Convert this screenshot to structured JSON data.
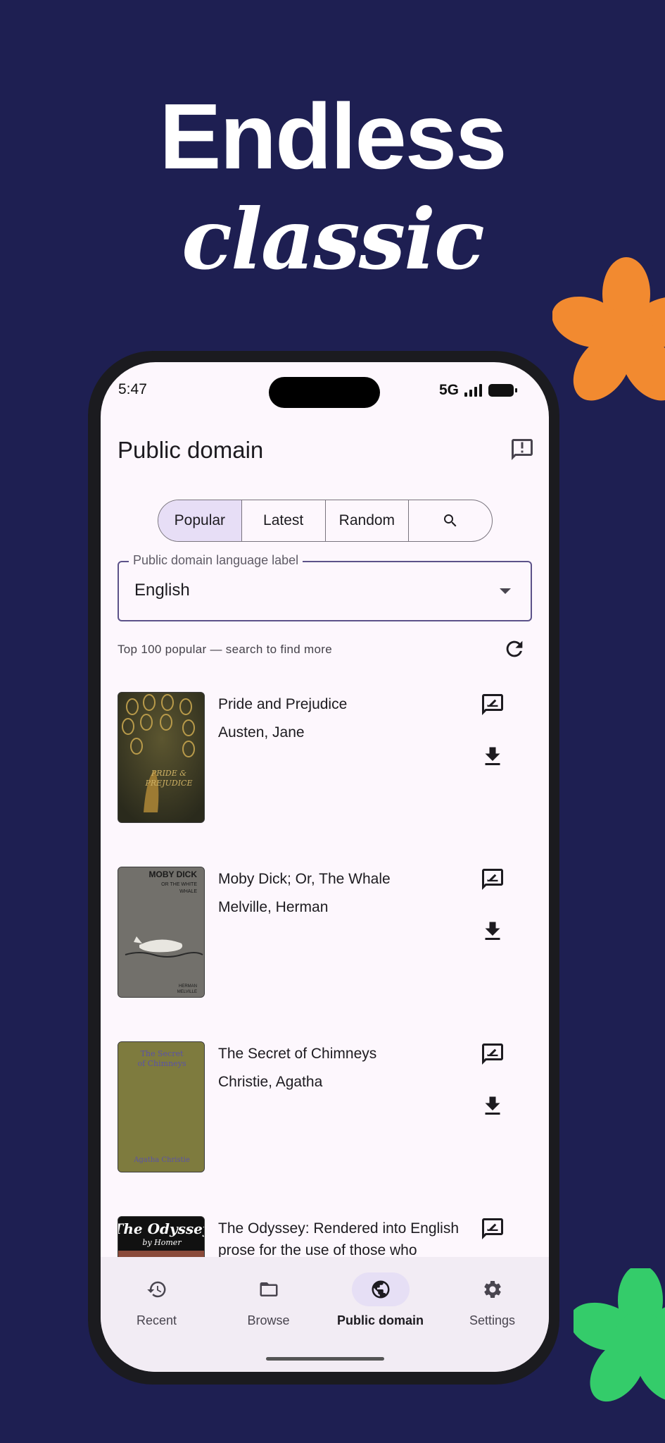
{
  "headline": {
    "line1": "Endless",
    "line2": "classic"
  },
  "status_bar": {
    "time": "5:47",
    "network": "5G"
  },
  "header": {
    "title": "Public domain",
    "feedback_icon": "feedback-icon"
  },
  "segments": [
    {
      "label": "Popular",
      "active": true
    },
    {
      "label": "Latest",
      "active": false
    },
    {
      "label": "Random",
      "active": false
    },
    {
      "label": "",
      "icon": "search-icon",
      "active": false
    }
  ],
  "language_select": {
    "label": "Public domain language label",
    "value": "English"
  },
  "info": {
    "text": "Top 100 popular — search to find more"
  },
  "books": [
    {
      "title": "Pride and Prejudice",
      "author": "Austen, Jane",
      "cover_text": "PRIDE & PREJUDICE"
    },
    {
      "title": "Moby Dick; Or, The Whale",
      "author": "Melville, Herman",
      "cover_text": "MOBY DICK",
      "cover_subtext": "OR THE WHITE WHALE",
      "cover_author": "HERMAN MELVILLE"
    },
    {
      "title": "The Secret of Chimneys",
      "author": "Christie, Agatha",
      "cover_text": "The Secret of Chimneys",
      "cover_author": "Agatha Christie"
    },
    {
      "title": "The Odyssey: Rendered into English prose for the use of those who",
      "author": "",
      "cover_text": "The Odyssey",
      "cover_author": "by Homer"
    }
  ],
  "nav": [
    {
      "label": "Recent",
      "icon": "history-icon",
      "active": false
    },
    {
      "label": "Browse",
      "icon": "folder-icon",
      "active": false
    },
    {
      "label": "Public domain",
      "icon": "globe-icon",
      "active": true
    },
    {
      "label": "Settings",
      "icon": "gear-icon",
      "active": false
    }
  ],
  "colors": {
    "background": "#1e1f52",
    "screen": "#fdf7fd",
    "accent": "#e7def6",
    "flower_orange": "#f28a30",
    "flower_green": "#34cc6a"
  }
}
